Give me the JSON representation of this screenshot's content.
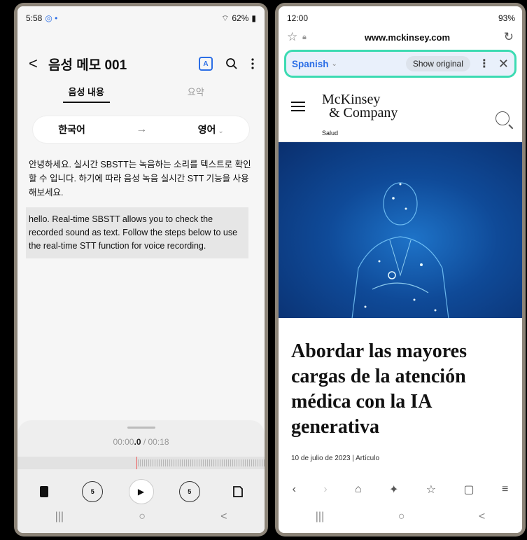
{
  "left": {
    "status": {
      "time": "5:58",
      "indicators": "◎ •",
      "battery": "62%"
    },
    "header": {
      "back_label": "<",
      "title": "음성 메모 001"
    },
    "tabs": [
      {
        "label": "음성 내용"
      },
      {
        "label": "요약"
      }
    ],
    "languages": {
      "source": "한국어",
      "arrow": "→",
      "target": "영어"
    },
    "korean_text": "안녕하세요. 실시간 SBSTT는 녹음하는 소리를 텍스트로 확인할 수 입니다. 하기에 따라 음성 녹음 실시간 STT 기능을 사용해보세요.",
    "english_text": "hello. Real-time SBSTT allows you to check the recorded sound as text. Follow the steps below to use the real-time STT function for voice recording.",
    "player": {
      "time_prefix": "00:00",
      "time_current": ".0",
      "time_total": " / 00:18",
      "skip_back": "5",
      "skip_fwd": "5"
    },
    "nav": {
      "recents": "|||",
      "home": "○",
      "back": "<"
    }
  },
  "right": {
    "status": {
      "time": "12:00",
      "battery": "93%"
    },
    "url": "www.mckinsey.com",
    "translate": {
      "language": "Spanish",
      "show_original": "Show original"
    },
    "site": {
      "logo_line1": "McKinsey",
      "logo_line2": "& Company",
      "section": "Salud"
    },
    "headline": "Abordar las mayores cargas de la atención médica con la IA generativa",
    "date": "10 de julio de 2023 | Artículo",
    "nav": {
      "recents": "|||",
      "home": "○",
      "back": "<"
    }
  },
  "colors": {
    "accent_blue": "#2b6ee6",
    "highlight_teal": "#3ddbb2",
    "hero_blue": "#0f4a98"
  }
}
